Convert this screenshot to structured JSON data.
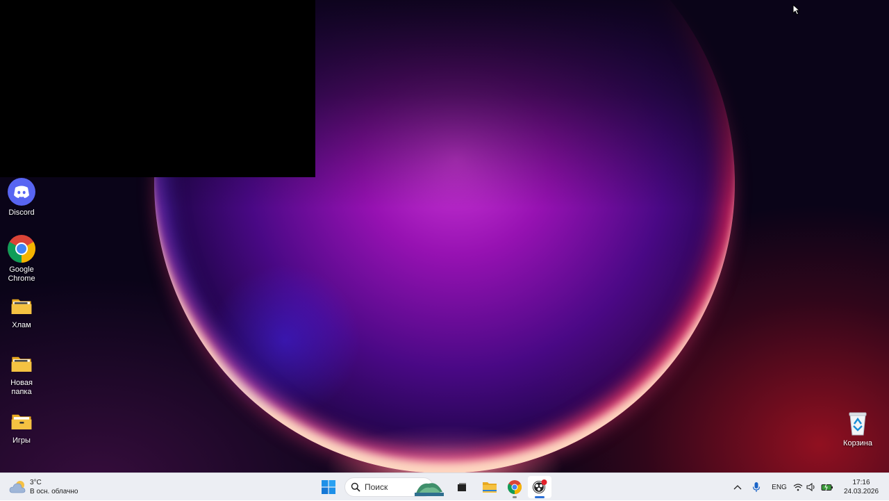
{
  "desktop": {
    "icons": [
      {
        "label": "Discord",
        "icon": "discord-icon"
      },
      {
        "label": "Google Chrome",
        "icon": "chrome-icon"
      },
      {
        "label": "Хлам",
        "icon": "folder-icon"
      },
      {
        "label": "Новая папка",
        "icon": "folder-icon"
      },
      {
        "label": "Игры",
        "icon": "folder-icon"
      },
      {
        "label": "Корзина",
        "icon": "recycle-bin-icon"
      }
    ]
  },
  "taskbar": {
    "weather": {
      "temperature": "3°C",
      "condition": "В осн. облачно",
      "icon": "cloudy-weather-icon"
    },
    "start": {
      "icon": "windows-start-icon"
    },
    "search": {
      "placeholder": "Поиск",
      "icon": "search-icon"
    },
    "apps": [
      {
        "name": "task-view",
        "icon": "task-view-icon",
        "running": false
      },
      {
        "name": "file-explorer",
        "icon": "folder-icon",
        "running": false
      },
      {
        "name": "google-chrome",
        "icon": "chrome-icon",
        "running": true
      },
      {
        "name": "obs",
        "icon": "obs-icon",
        "running": true,
        "active": true
      }
    ],
    "tray": {
      "language": "ENG",
      "time": "17:16",
      "date": "24.03.2026"
    }
  },
  "colors": {
    "taskbar_bg": "#eceef3",
    "discord": "#5865f2",
    "folder": "#f5c242",
    "accent": "#2a6fd6"
  }
}
